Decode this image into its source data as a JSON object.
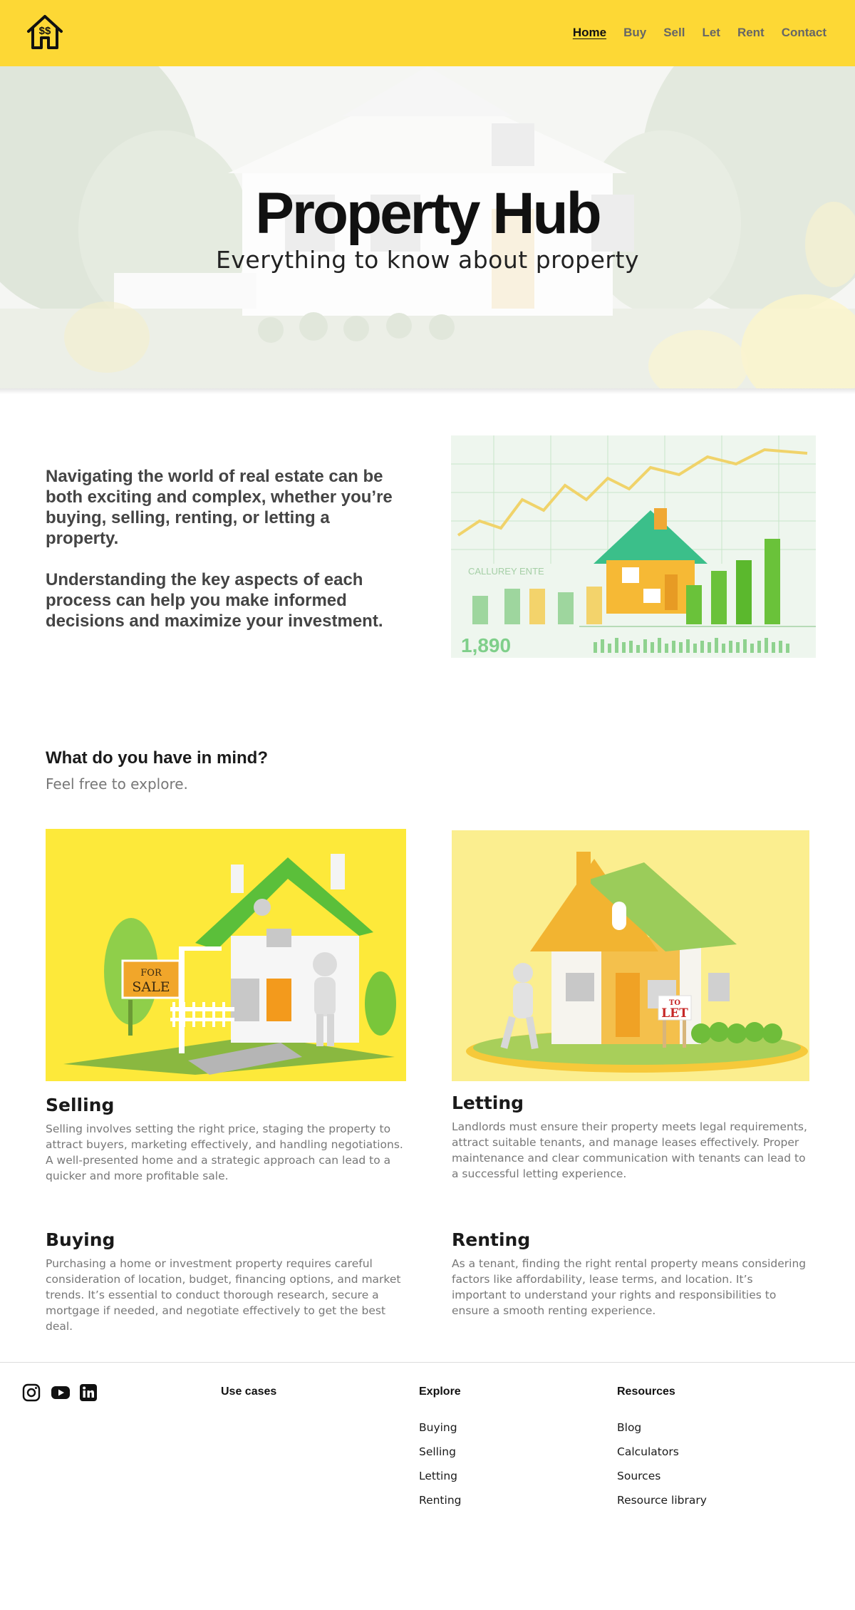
{
  "header": {
    "logo_text": "$$",
    "nav": [
      "Home",
      "Buy",
      "Sell",
      "Let",
      "Rent",
      "Contact"
    ],
    "active": "Home"
  },
  "hero": {
    "title": "Property Hub",
    "subtitle": "Everything to know about property"
  },
  "intro": {
    "paragraph1": "Navigating the world of real estate can be both exciting and complex, whether you’re buying, selling, renting, or letting a property.",
    "paragraph2": "Understanding the key aspects of each process can help you make informed decisions and maximize your investment.",
    "image_texts": {
      "big_number": "1,890",
      "label": "CALLUREY ENTE"
    }
  },
  "explore": {
    "title": "What do you have in mind?",
    "subtitle": "Feel free to explore."
  },
  "cards": {
    "selling": {
      "title": "Selling",
      "text": "Selling involves setting the right price, staging the property to attract buyers, marketing effectively, and handling negotiations. A well-presented home and a strategic approach can lead to a quicker and more profitable sale.",
      "sign_top": "FOR",
      "sign_bottom": "SALE"
    },
    "letting": {
      "title": "Letting",
      "text": "Landlords must ensure their property meets legal requirements, attract suitable tenants, and manage leases effectively. Proper maintenance and clear communication with tenants can lead to a successful letting experience.",
      "sign_top": "TO",
      "sign_bottom": "LET"
    },
    "buying": {
      "title": "Buying",
      "text": "Purchasing a home or investment property requires careful consideration of location, budget, financing options, and market trends. It’s essential to conduct thorough research, secure a mortgage if needed, and negotiate effectively to get the best deal."
    },
    "renting": {
      "title": "Renting",
      "text": "As a tenant, finding the right rental property means considering factors like affordability, lease terms, and location. It’s important to understand your rights and responsibilities to ensure a smooth renting experience."
    }
  },
  "footer": {
    "social": [
      "instagram-icon",
      "youtube-icon",
      "linkedin-icon"
    ],
    "use_cases": {
      "title": "Use cases"
    },
    "explore": {
      "title": "Explore",
      "links": [
        "Buying",
        "Selling",
        "Letting",
        "Renting"
      ]
    },
    "resources": {
      "title": "Resources",
      "links": [
        "Blog",
        "Calculators",
        "Sources",
        "Resource library"
      ]
    }
  },
  "colors": {
    "brand_yellow": "#fdd835",
    "text_dark": "#1a1a1a",
    "text_muted": "#777777",
    "intro_text": "#444444"
  }
}
